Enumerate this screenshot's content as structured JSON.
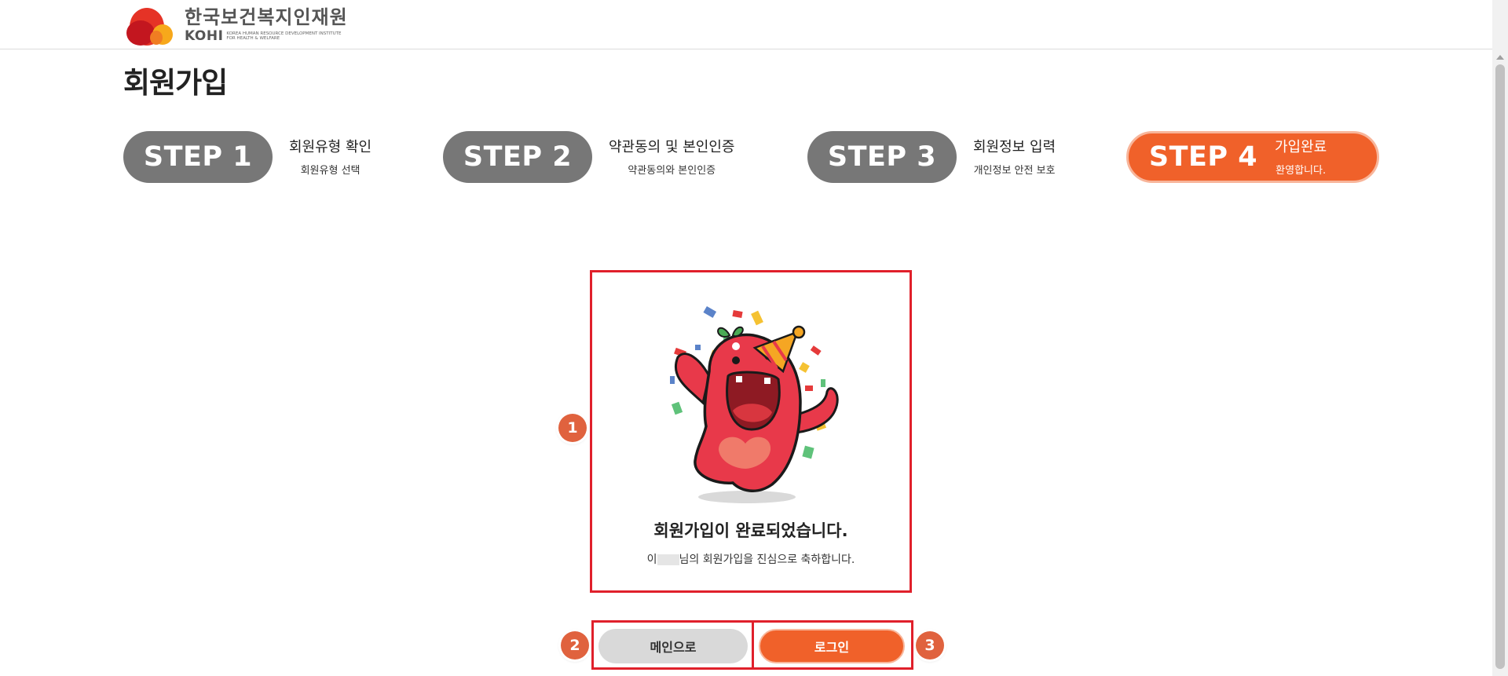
{
  "header": {
    "logo_ko": "한국보건복지인재원",
    "logo_en": "KOHI",
    "logo_sub": "KOREA HUMAN RESOURCE DEVELOPMENT INSTITUTE FOR HEALTH & WELFARE"
  },
  "page": {
    "title": "회원가입"
  },
  "steps": [
    {
      "label": "STEP 1",
      "title": "회원유형 확인",
      "desc": "회원유형 선택",
      "active": false
    },
    {
      "label": "STEP 2",
      "title": "약관동의 및 본인인증",
      "desc": "약관동의와 본인인증",
      "active": false
    },
    {
      "label": "STEP 3",
      "title": "회원정보 입력",
      "desc": "개인정보 안전 보호",
      "active": false
    },
    {
      "label": "STEP 4",
      "title": "가입완료",
      "desc": "환영합니다.",
      "active": true
    }
  ],
  "completion": {
    "title": "회원가입이 완료되었습니다.",
    "msg_prefix": "이",
    "msg_suffix": "님의 회원가입을 진심으로 축하합니다."
  },
  "buttons": {
    "main": "메인으로",
    "login": "로그인"
  },
  "annotations": [
    "1",
    "2",
    "3"
  ],
  "colors": {
    "accent": "#f0612a",
    "step_inactive": "#777777",
    "highlight": "#e0202b",
    "badge": "#e0623e"
  }
}
